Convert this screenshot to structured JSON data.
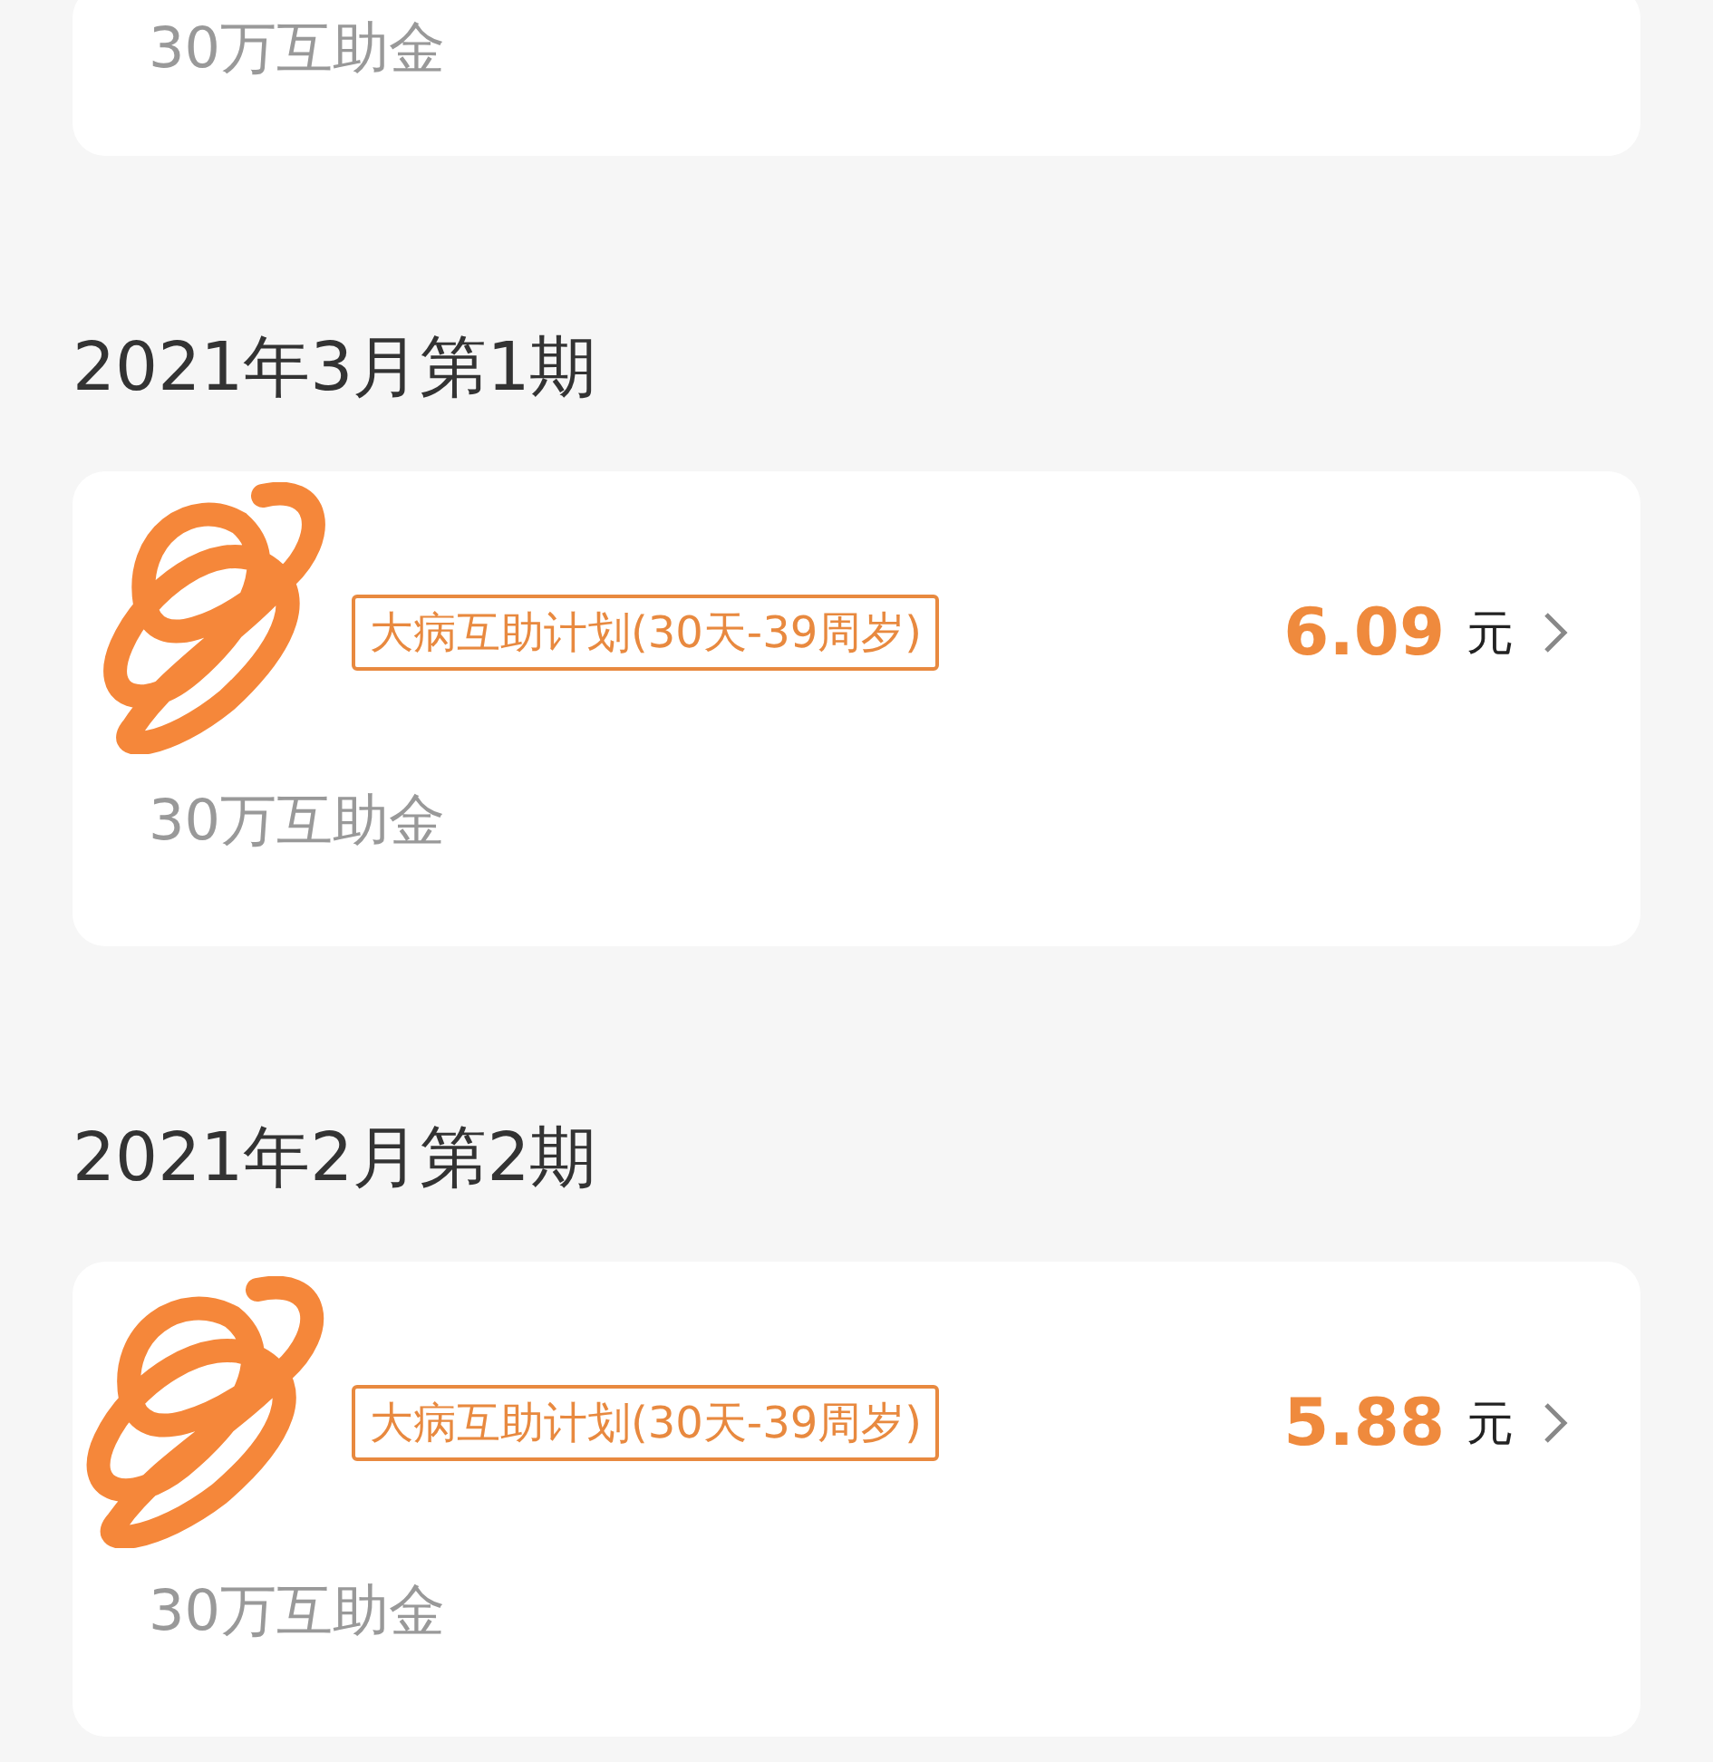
{
  "top_card": {
    "coverage": "30万互助金"
  },
  "periods": [
    {
      "heading": "2021年3月第1期",
      "plan_tag": "大病互助计划(30天-39周岁)",
      "amount": "6.09",
      "unit": "元",
      "coverage": "30万互助金"
    },
    {
      "heading": "2021年2月第2期",
      "plan_tag": "大病互助计划(30天-39周岁)",
      "amount": "5.88",
      "unit": "元",
      "coverage": "30万互助金"
    }
  ]
}
